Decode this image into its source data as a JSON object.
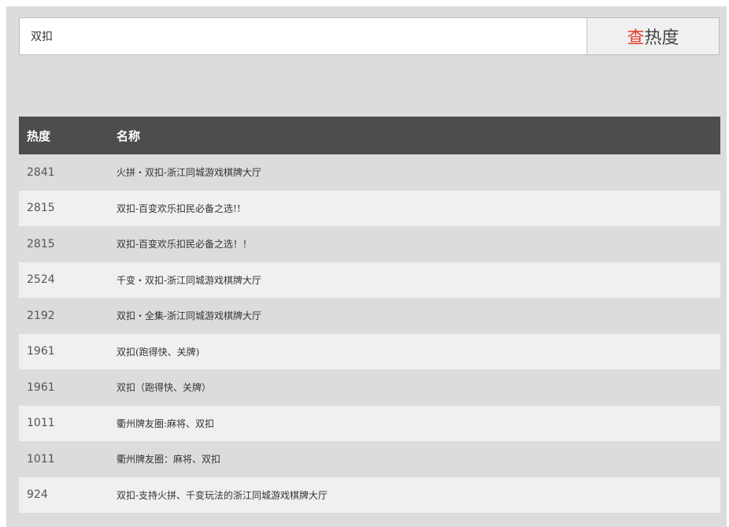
{
  "search": {
    "value": "双扣",
    "button_accent": "查",
    "button_rest": "热度"
  },
  "table": {
    "headers": [
      "热度",
      "名称"
    ],
    "rows": [
      {
        "heat": "2841",
        "name": "火拼・双扣-浙江同城游戏棋牌大厅"
      },
      {
        "heat": "2815",
        "name": "双扣-百变欢乐扣民必备之选!!"
      },
      {
        "heat": "2815",
        "name": "双扣-百变欢乐扣民必备之选！！"
      },
      {
        "heat": "2524",
        "name": "千变・双扣-浙江同城游戏棋牌大厅"
      },
      {
        "heat": "2192",
        "name": "双扣・全集-浙江同城游戏棋牌大厅"
      },
      {
        "heat": "1961",
        "name": "双扣(跑得快、关牌)"
      },
      {
        "heat": "1961",
        "name": "双扣（跑得快、关牌）"
      },
      {
        "heat": "1011",
        "name": "衢州牌友圈:麻将、双扣"
      },
      {
        "heat": "1011",
        "name": "衢州牌友圈：麻将、双扣"
      },
      {
        "heat": "924",
        "name": "双扣-支持火拼、千变玩法的浙江同城游戏棋牌大厅"
      }
    ]
  },
  "colors": {
    "accent": "#e2412b",
    "header_bg": "#4d4d4d",
    "page_bg": "#dcdcdc",
    "row_alt_bg": "#f0f0f0"
  }
}
